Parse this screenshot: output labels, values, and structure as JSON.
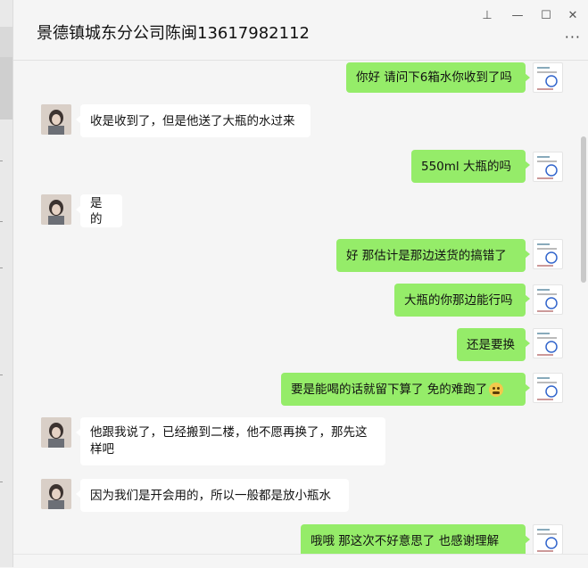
{
  "window": {
    "title": "景德镇城东分公司陈闽13617982112",
    "pin_icon": "⊥",
    "minimize_icon": "—",
    "maximize_icon": "☐",
    "close_icon": "✕",
    "more_icon": "···"
  },
  "messages": [
    {
      "dir": "out",
      "text": "你好 请问下6箱水你收到了吗"
    },
    {
      "dir": "in",
      "text": "收是收到了，但是他送了大瓶的水过来"
    },
    {
      "dir": "out",
      "text": "550ml  大瓶的吗"
    },
    {
      "dir": "in",
      "text": "是的"
    },
    {
      "dir": "out",
      "text": "好  那估计是那边送货的搞错了"
    },
    {
      "dir": "out",
      "text": "大瓶的你那边能行吗"
    },
    {
      "dir": "out",
      "text": "还是要换"
    },
    {
      "dir": "out",
      "text": "要是能喝的话就留下算了  免的难跑了",
      "emoji": "grimace-emoji"
    },
    {
      "dir": "in",
      "text": "他跟我说了，已经搬到二楼，他不愿再换了，那先这样吧"
    },
    {
      "dir": "in",
      "text": "因为我们是开会用的，所以一般都是放小瓶水"
    },
    {
      "dir": "out",
      "text": "哦哦  那这次不好意思了   也感谢理解"
    }
  ]
}
